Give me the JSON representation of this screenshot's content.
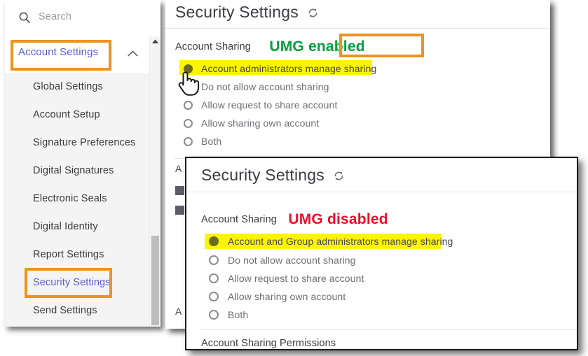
{
  "search": {
    "placeholder": "Search",
    "icon": "search-icon"
  },
  "sidebar": {
    "section": {
      "label": "Account Settings",
      "expanded_icon": "chevron-up-icon"
    },
    "items": [
      {
        "label": "Global Settings",
        "active": false
      },
      {
        "label": "Account Setup",
        "active": false
      },
      {
        "label": "Signature Preferences",
        "active": false
      },
      {
        "label": "Digital Signatures",
        "active": false
      },
      {
        "label": "Electronic Seals",
        "active": false
      },
      {
        "label": "Digital Identity",
        "active": false
      },
      {
        "label": "Report Settings",
        "active": false
      },
      {
        "label": "Security Settings",
        "active": true
      },
      {
        "label": "Send Settings",
        "active": false
      }
    ],
    "scrollbar": {
      "up_icon": "scroll-up-arrow-icon"
    }
  },
  "back_panel": {
    "title": "Security Settings",
    "refresh_icon": "refresh-icon",
    "section_label": "Account Sharing",
    "annotation": "UMG enabled",
    "annotation_color": "#00a03c",
    "options": [
      {
        "label": "Account administrators manage sharing",
        "checked": true,
        "highlighted": true
      },
      {
        "label": "Do not allow account sharing",
        "checked": false,
        "highlighted": false
      },
      {
        "label": "Allow request to share account",
        "checked": false,
        "highlighted": false
      },
      {
        "label": "Allow sharing own account",
        "checked": false,
        "highlighted": false
      },
      {
        "label": "Both",
        "checked": false,
        "highlighted": false
      }
    ],
    "occluded": {
      "line_1": "A",
      "line_2": "A"
    }
  },
  "front_panel": {
    "title": "Security Settings",
    "refresh_icon": "refresh-icon",
    "section_label": "Account Sharing",
    "annotation": "UMG disabled",
    "annotation_color": "#e8102a",
    "options": [
      {
        "label": "Account and Group administrators manage sharing",
        "checked": true,
        "highlighted": true
      },
      {
        "label": "Do not allow account sharing",
        "checked": false,
        "highlighted": false
      },
      {
        "label": "Allow request to share account",
        "checked": false,
        "highlighted": false
      },
      {
        "label": "Allow sharing own account",
        "checked": false,
        "highlighted": false
      },
      {
        "label": "Both",
        "checked": false,
        "highlighted": false
      }
    ],
    "permissions_label": "Account Sharing Permissions"
  },
  "highlight": {
    "box_color": "#f0921e",
    "mark_color": "#fcf400"
  },
  "cursor": {
    "icon": "hand-pointer-cursor"
  }
}
